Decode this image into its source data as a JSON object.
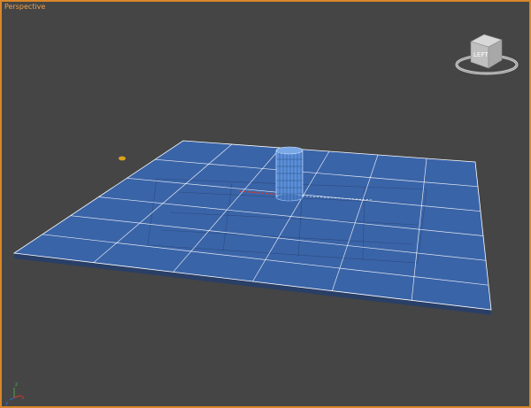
{
  "viewport": {
    "label": "Perspective",
    "border_color": "#d9862b",
    "background_color": "#454545"
  },
  "view_cube": {
    "face_label": "LEFT",
    "icon": "view-cube-icon"
  },
  "axis_tripod": {
    "x_label": "x",
    "y_label": "y",
    "z_label": "z"
  },
  "colors": {
    "plane_fill": "#3a64a8",
    "plane_grid": "#ffffff",
    "cylinder_fill": "#5b8fd8",
    "helper_object": "#d9a21b"
  }
}
